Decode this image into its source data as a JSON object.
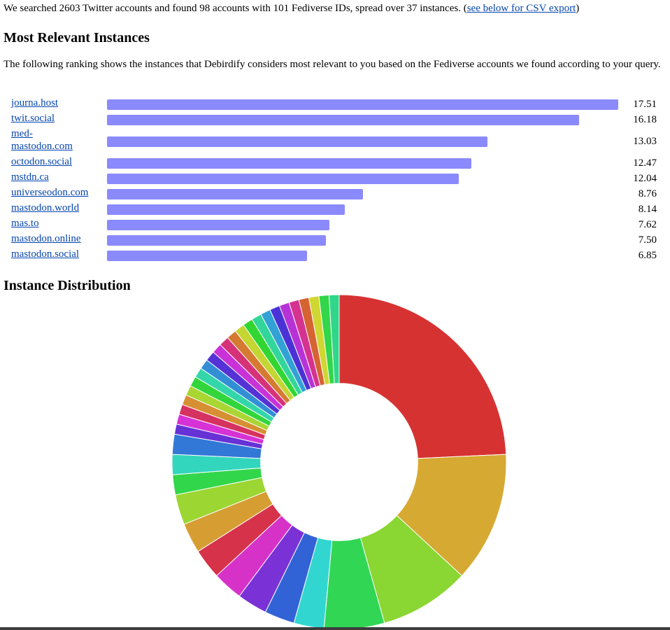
{
  "intro": {
    "text": "We searched 2603 Twitter accounts and found 98 accounts with 101 Fediverse IDs, spread over 37 instances. (",
    "link": "see below for CSV export",
    "tail": ")"
  },
  "relevant": {
    "heading": "Most Relevant Instances",
    "description": "The following ranking shows the instances that Debirdify considers most relevant to you based on the Fediverse accounts we found according to your query."
  },
  "distribution": {
    "heading": "Instance Distribution"
  },
  "colors": {
    "bar": "#8a8afc",
    "link": "#0645ad"
  },
  "chart_data": [
    {
      "type": "bar",
      "orientation": "horizontal",
      "categories": [
        "journa.host",
        "twit.social",
        "med-mastodon.com",
        "octodon.social",
        "mstdn.ca",
        "universeodon.com",
        "mastodon.world",
        "mas.to",
        "mastodon.online",
        "mastodon.social"
      ],
      "category_display": [
        "journa.host",
        "twit.social",
        "med-\nmastodon.com",
        "octodon.social",
        "mstdn.ca",
        "universeodon.com",
        "mastodon.world",
        "mas.to",
        "mastodon.online",
        "mastodon.social"
      ],
      "values": [
        17.51,
        16.18,
        13.03,
        12.47,
        12.04,
        8.76,
        8.14,
        7.62,
        7.5,
        6.85
      ],
      "value_labels": [
        "17.51",
        "16.18",
        "13.03",
        "12.47",
        "12.04",
        "8.76",
        "8.14",
        "7.62",
        "7.50",
        "6.85"
      ],
      "color": "#8a8afc"
    },
    {
      "type": "pie",
      "hole": 0.47,
      "slice_accounts": [
        25,
        13,
        9,
        6,
        3,
        3,
        3,
        3,
        3,
        3,
        3,
        2,
        2,
        2,
        1,
        1,
        1,
        1,
        1,
        1,
        1,
        1,
        1,
        1,
        1,
        1,
        1,
        1,
        1,
        1,
        1,
        1,
        1,
        1,
        1,
        1,
        1
      ],
      "colors": [
        "#d63232",
        "#d6a932",
        "#8ad632",
        "#32d655",
        "#32d6d0",
        "#3263d6",
        "#7a32d6",
        "#d632c8",
        "#d6324a",
        "#d69e32",
        "#9bd632",
        "#32d64a",
        "#32d6bd",
        "#3278d6",
        "#6632d6",
        "#d632d6",
        "#d63261",
        "#d68f32",
        "#a9d632",
        "#32d63c",
        "#32d6a9",
        "#328fd6",
        "#5532d6",
        "#c832d6",
        "#d63278",
        "#d67a32",
        "#c3d632",
        "#32d632",
        "#32d69b",
        "#32a1d6",
        "#4a32d6",
        "#b732d6",
        "#d6328f",
        "#d66332",
        "#d0d632",
        "#32d64a",
        "#32d68a"
      ]
    }
  ]
}
